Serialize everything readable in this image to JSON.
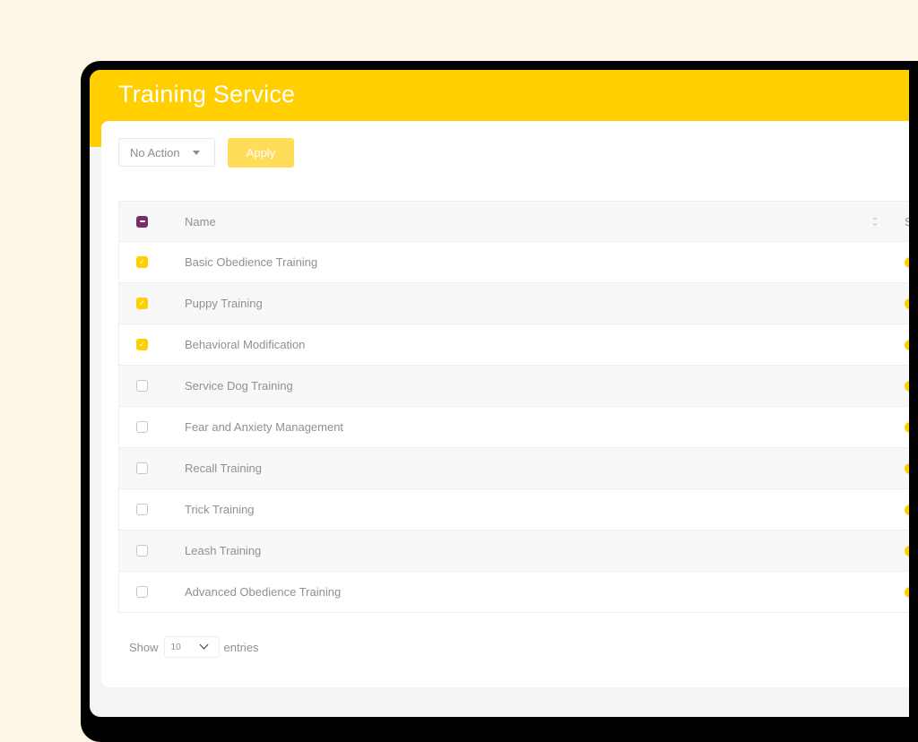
{
  "page": {
    "title": "Training Service"
  },
  "toolbar": {
    "bulk_action_value": "No Action",
    "apply_label": "Apply"
  },
  "table": {
    "columns": [
      "Name",
      "S"
    ],
    "header_checkbox_state": "indeterminate",
    "rows": [
      {
        "name": "Basic Obedience Training",
        "checked": true,
        "status_color": "#ffcf00"
      },
      {
        "name": "Puppy Training",
        "checked": true,
        "status_color": "#ffcf00"
      },
      {
        "name": "Behavioral Modification",
        "checked": true,
        "status_color": "#ffcf00"
      },
      {
        "name": "Service Dog Training",
        "checked": false,
        "status_color": "#ffcf00"
      },
      {
        "name": "Fear and Anxiety Management",
        "checked": false,
        "status_color": "#ffcf00"
      },
      {
        "name": "Recall Training",
        "checked": false,
        "status_color": "#ffcf00"
      },
      {
        "name": "Trick Training",
        "checked": false,
        "status_color": "#ffcf00"
      },
      {
        "name": "Leash Training",
        "checked": false,
        "status_color": "#ffcf00"
      },
      {
        "name": "Advanced Obedience Training",
        "checked": false,
        "status_color": "#ffcf00"
      }
    ]
  },
  "footer": {
    "show_label": "Show",
    "page_size_value": "10",
    "entries_label": "entries"
  },
  "colors": {
    "accent": "#ffcf00",
    "apply_button": "#ffdc5a",
    "header_checkbox": "#7a2b6a",
    "background": "#fdf6e6"
  }
}
